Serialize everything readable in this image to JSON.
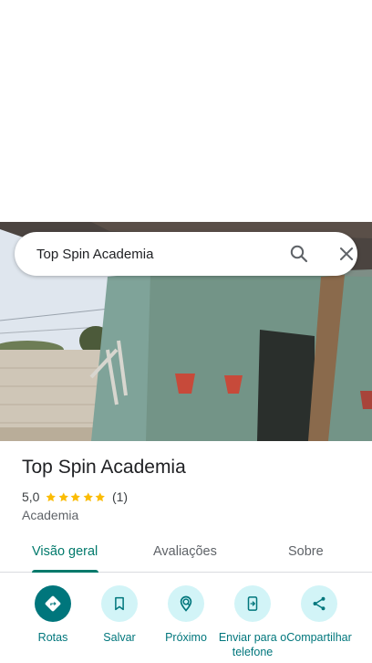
{
  "search": {
    "query": "Top Spin Academia"
  },
  "place": {
    "title": "Top Spin Academia",
    "rating": "5,0",
    "stars": 5,
    "review_count": "(1)",
    "category": "Academia"
  },
  "tabs": [
    {
      "label": "Visão geral",
      "active": true
    },
    {
      "label": "Avaliações",
      "active": false
    },
    {
      "label": "Sobre",
      "active": false
    }
  ],
  "actions": [
    {
      "label": "Rotas",
      "icon": "directions-icon"
    },
    {
      "label": "Salvar",
      "icon": "bookmark-icon"
    },
    {
      "label": "Próximo",
      "icon": "nearby-icon"
    },
    {
      "label": "Enviar para o telefone",
      "icon": "send-to-phone-icon"
    },
    {
      "label": "Compartilhar",
      "icon": "share-icon"
    }
  ],
  "colors": {
    "accent": "#00767c",
    "action_bg": "#d2f4f7",
    "star": "#fbbc04"
  }
}
